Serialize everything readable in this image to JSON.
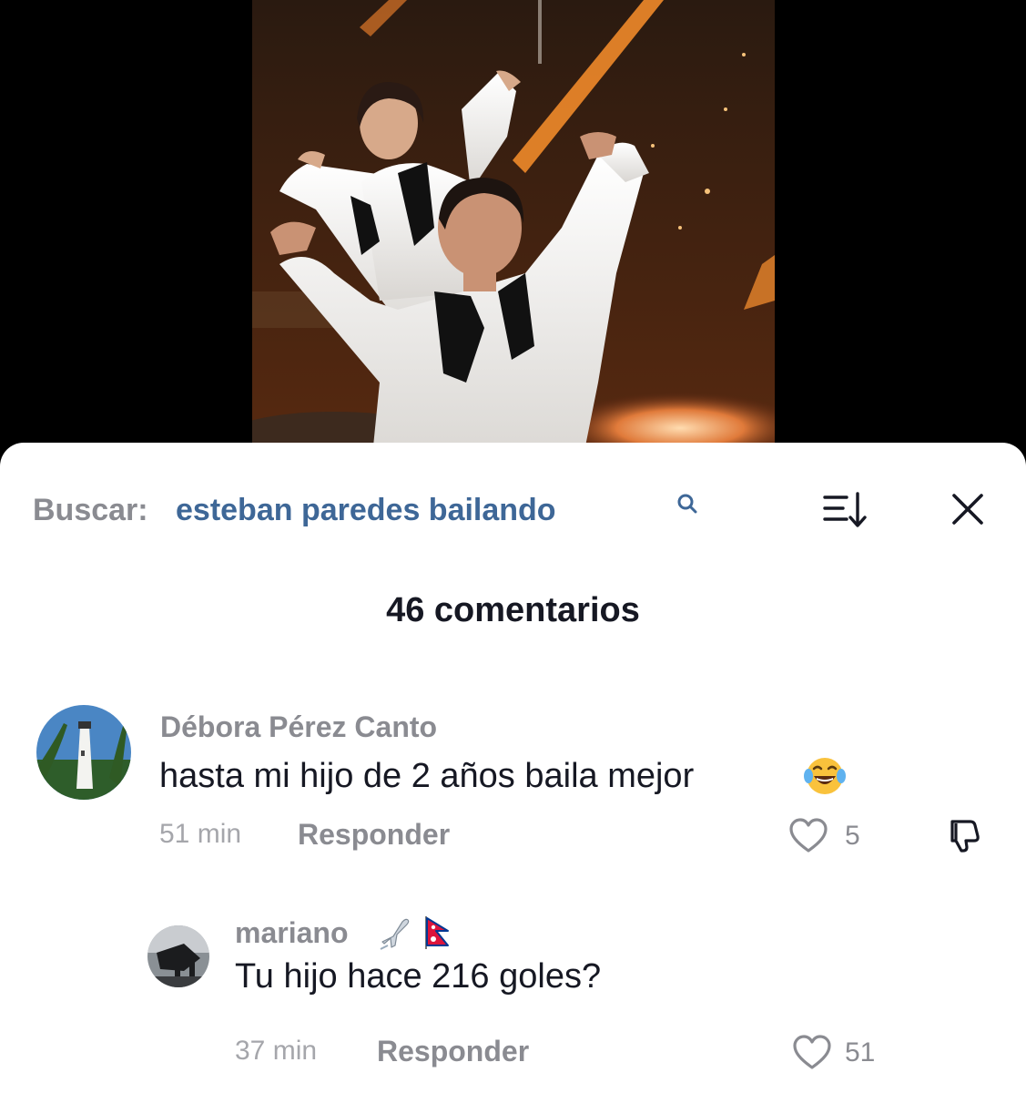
{
  "search": {
    "prefix": "Buscar:",
    "term": "esteban paredes bailando"
  },
  "comments_count_label": "46 comentarios",
  "comments": [
    {
      "username": "Débora Pérez Canto",
      "text": "hasta mi hijo de 2 años baila mejor",
      "emoji": "😂",
      "time": "51 min",
      "reply_label": "Responder",
      "likes": "5"
    }
  ],
  "replies": [
    {
      "username": "mariano",
      "badges": [
        "airplane-icon",
        "nepal-flag-icon"
      ],
      "text": "Tu hijo hace 216 goles?",
      "time": "37 min",
      "reply_label": "Responder",
      "likes": "51"
    }
  ],
  "colors": {
    "search_term": "#3e6797",
    "muted_text": "#8a8b91",
    "primary_text": "#161823"
  }
}
